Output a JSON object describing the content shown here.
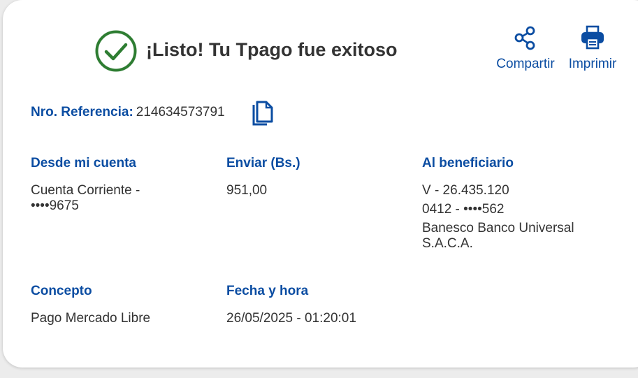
{
  "header": {
    "title": "¡Listo! Tu Tpago fue exitoso",
    "status_icon": "check-circle-icon",
    "success_color": "#2e7d32"
  },
  "actions": {
    "share": {
      "label": "Compartir",
      "icon": "share-icon"
    },
    "print": {
      "label": "Imprimir",
      "icon": "printer-icon"
    }
  },
  "reference": {
    "label": "Nro. Referencia:",
    "value": "214634573791",
    "copy_icon": "copy-icon"
  },
  "details": {
    "origin": {
      "label": "Desde mi cuenta",
      "line1": "Cuenta Corriente -",
      "line2": "••••9675"
    },
    "amount": {
      "label": "Enviar (Bs.)",
      "value": "951,00"
    },
    "beneficiary": {
      "label": "Al beneficiario",
      "id": "V - 26.435.120",
      "phone": "0412 - ••••562",
      "bank_line1": "Banesco Banco Universal",
      "bank_line2": "S.A.C.A."
    },
    "concept": {
      "label": "Concepto",
      "value": "Pago Mercado Libre"
    },
    "datetime": {
      "label": "Fecha y hora",
      "value": "26/05/2025 - 01:20:01"
    }
  },
  "colors": {
    "accent": "#0b4da2",
    "text": "#333333",
    "background": "#ececec",
    "card": "#ffffff"
  }
}
